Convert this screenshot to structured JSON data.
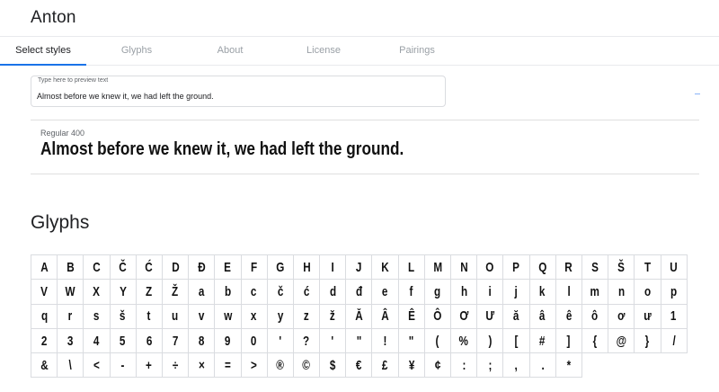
{
  "font": {
    "title": "Anton"
  },
  "tabs": [
    {
      "label": "Select styles",
      "active": true
    },
    {
      "label": "Glyphs",
      "active": false
    },
    {
      "label": "About",
      "active": false
    },
    {
      "label": "License",
      "active": false
    },
    {
      "label": "Pairings",
      "active": false
    }
  ],
  "preview": {
    "label": "Type here to preview text",
    "value": "Almost before we knew it, we had left the ground."
  },
  "style": {
    "name": "Regular 400",
    "sample": "Almost before we knew it, we had left the ground."
  },
  "glyphs": {
    "heading": "Glyphs",
    "characters": [
      "A",
      "B",
      "C",
      "Č",
      "Ć",
      "D",
      "Đ",
      "E",
      "F",
      "G",
      "H",
      "I",
      "J",
      "K",
      "L",
      "M",
      "N",
      "O",
      "P",
      "Q",
      "R",
      "S",
      "Š",
      "T",
      "U",
      "V",
      "W",
      "X",
      "Y",
      "Z",
      "Ž",
      "a",
      "b",
      "c",
      "č",
      "ć",
      "d",
      "đ",
      "e",
      "f",
      "g",
      "h",
      "i",
      "j",
      "k",
      "l",
      "m",
      "n",
      "o",
      "p",
      "q",
      "r",
      "s",
      "š",
      "t",
      "u",
      "v",
      "w",
      "x",
      "y",
      "z",
      "ž",
      "Ă",
      "Â",
      "Ê",
      "Ô",
      "Ơ",
      "Ư",
      "ă",
      "â",
      "ê",
      "ô",
      "ơ",
      "ư",
      "1",
      "2",
      "3",
      "4",
      "5",
      "6",
      "7",
      "8",
      "9",
      "0",
      "'",
      "?",
      "'",
      "\"",
      "!",
      "\"",
      "(",
      "%",
      ")",
      "[",
      "#",
      "]",
      "{",
      "@",
      "}",
      "/",
      "&",
      "\\",
      "<",
      "-",
      "+",
      "÷",
      "×",
      "=",
      ">",
      "®",
      "©",
      "$",
      "€",
      "£",
      "¥",
      "¢",
      ":",
      ";",
      ",",
      ".",
      "*"
    ]
  }
}
